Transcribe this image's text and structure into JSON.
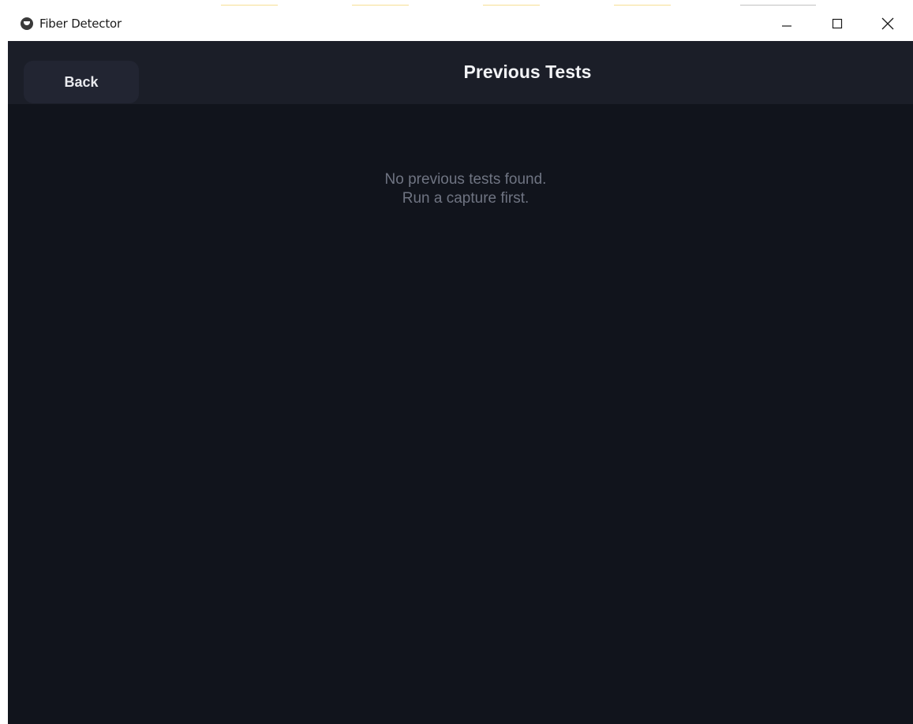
{
  "window": {
    "title": "Fiber Detector",
    "app_icon": "fiber-detector-app-icon",
    "controls": {
      "minimize_icon": "minimize-icon",
      "maximize_icon": "maximize-icon",
      "close_icon": "close-icon"
    }
  },
  "header": {
    "back_label": "Back",
    "title": "Previous Tests"
  },
  "empty_state": {
    "line1": "No previous tests found.",
    "line2": "Run a capture first."
  },
  "colors": {
    "background": "#11141c",
    "header_background": "#1b1e28",
    "button_background": "#222532",
    "muted_text": "#6f7482",
    "title_text": "#f2f3f6"
  }
}
